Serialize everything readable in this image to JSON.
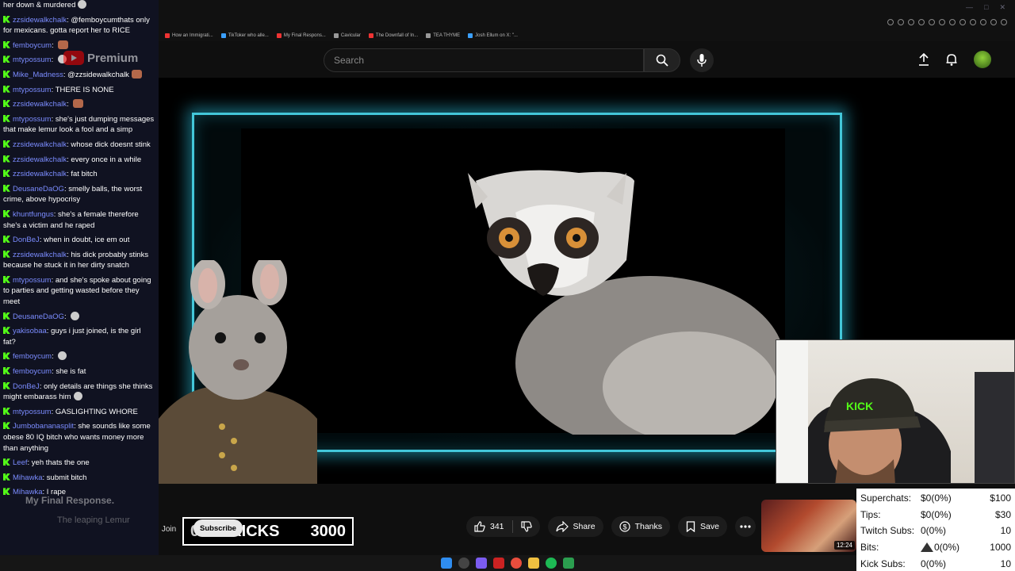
{
  "browser": {
    "bookmarks": [
      {
        "label": "How an Immigrati...",
        "icon": "youtube-icon"
      },
      {
        "label": "TikToker who alle...",
        "icon": "tiktok-icon"
      },
      {
        "label": "My Final Respons...",
        "icon": "youtube-icon"
      },
      {
        "label": "Cavicular",
        "icon": "folder-icon"
      },
      {
        "label": "The Downfall of In...",
        "icon": "youtube-icon"
      },
      {
        "label": "TEA THYME",
        "icon": "folder-icon"
      },
      {
        "label": "Josh Ellum on X: \"...",
        "icon": "x-icon"
      }
    ]
  },
  "youtube": {
    "logo_text": "Premium",
    "search_placeholder": "Search",
    "channel_name": "The leaping Lemur",
    "video_title": "My Final Response.",
    "join_label": "Join",
    "subscribe_label": "Subscribe",
    "likes": "341",
    "share_label": "Share",
    "thanks_label": "Thanks",
    "save_label": "Save",
    "thumb_duration": "12:24"
  },
  "kick_counter": {
    "current": "0",
    "label": "KICKS",
    "goal": "3000"
  },
  "chat": [
    {
      "user": "",
      "text": "her down & murdered",
      "emote": "face"
    },
    {
      "user": "zzsidewalkchalk",
      "text": "@femboycumthats only for mexicans. gotta report her to RICE",
      "emote": ""
    },
    {
      "user": "femboycum",
      "text": "",
      "emote": "box"
    },
    {
      "user": "mtypossum",
      "text": "",
      "emote": "face"
    },
    {
      "user": "Mike_Madness",
      "text": "@zzsidewalkchalk",
      "emote": "box"
    },
    {
      "user": "mtypossum",
      "text": "THERE IS NONE",
      "emote": ""
    },
    {
      "user": "zzsidewalkchalk",
      "text": "",
      "emote": "box"
    },
    {
      "user": "mtypossum",
      "text": "she's just dumping messages that make lemur look a fool and a simp",
      "emote": ""
    },
    {
      "user": "zzsidewalkchalk",
      "text": "whose dick doesnt stink",
      "emote": ""
    },
    {
      "user": "zzsidewalkchalk",
      "text": "every once in a while",
      "emote": ""
    },
    {
      "user": "zzsidewalkchalk",
      "text": "fat bitch",
      "emote": ""
    },
    {
      "user": "DeusaneDaOG",
      "text": "smelly balls, the worst crime, above hypocrisy",
      "emote": ""
    },
    {
      "user": "khuntfungus",
      "text": "she's a female therefore she's a victim and he raped",
      "emote": ""
    },
    {
      "user": "DonBeJ",
      "text": "when in doubt, ice em out",
      "emote": ""
    },
    {
      "user": "zzsidewalkchalk",
      "text": "his dick probably stinks because he stuck it in her dirty snatch",
      "emote": ""
    },
    {
      "user": "mtypossum",
      "text": "and she's spoke about going to parties and getting wasted before they meet",
      "emote": ""
    },
    {
      "user": "DeusaneDaOG",
      "text": "",
      "emote": "face"
    },
    {
      "user": "yakisobaa",
      "text": "guys i just joined, is the girl fat?",
      "emote": ""
    },
    {
      "user": "femboycum",
      "text": "",
      "emote": "face"
    },
    {
      "user": "femboycum",
      "text": "she is fat",
      "emote": ""
    },
    {
      "user": "DonBeJ",
      "text": "only details are things she thinks might embarass him",
      "emote": "face"
    },
    {
      "user": "mtypossum",
      "text": "GASLIGHTING WHORE",
      "emote": ""
    },
    {
      "user": "Jumbobananasplit",
      "text": "she sounds like some obese 80 IQ bitch who wants money more than anything",
      "emote": ""
    },
    {
      "user": "Leef",
      "text": "yeh thats the one",
      "emote": ""
    },
    {
      "user": "Mihawka",
      "text": "submit bitch",
      "emote": ""
    },
    {
      "user": "Mihawka",
      "text": "I rape",
      "emote": ""
    }
  ],
  "stats": [
    {
      "label": "Superchats:",
      "value": "$0(0%)",
      "goal": "$100",
      "icon": ""
    },
    {
      "label": "Tips:",
      "value": "$0(0%)",
      "goal": "$30",
      "icon": ""
    },
    {
      "label": "Twitch Subs:",
      "value": "0(0%)",
      "goal": "10",
      "icon": ""
    },
    {
      "label": "Bits:",
      "value": "0(0%)",
      "goal": "1000",
      "icon": "warning-icon"
    },
    {
      "label": "Kick Subs:",
      "value": "0(0%)",
      "goal": "10",
      "icon": ""
    }
  ],
  "colors": {
    "kick_green": "#53fc18",
    "chat_user": "#7b8cff",
    "neon_frame": "#43c7d9",
    "youtube_red": "#ff0000"
  }
}
